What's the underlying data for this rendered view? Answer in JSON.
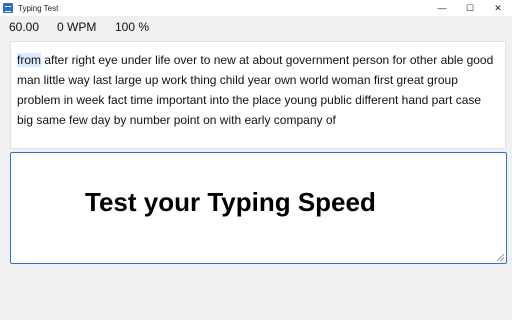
{
  "window": {
    "title": "Typing Test",
    "controls": {
      "minimize": "—",
      "maximize": "☐",
      "close": "✕"
    }
  },
  "stats": {
    "timer": "60.00",
    "wpm": "0 WPM",
    "accuracy": "100 %"
  },
  "passage": {
    "current_word": "from",
    "remaining_text": " after right eye under life over to new at about government person for other able good man little way last large up work thing child year own world woman first great group problem in week fact time important into the place young public different hand part case big same few day by number point on with early company of"
  },
  "input": {
    "prompt": "Test your Typing Speed"
  },
  "colors": {
    "accent": "#2d74d1",
    "highlight": "#d9ebff",
    "background": "#f0f0f0"
  },
  "icons": [
    "typing-test-app-icon",
    "minimize-icon",
    "maximize-icon",
    "close-icon",
    "resize-grip-icon"
  ]
}
